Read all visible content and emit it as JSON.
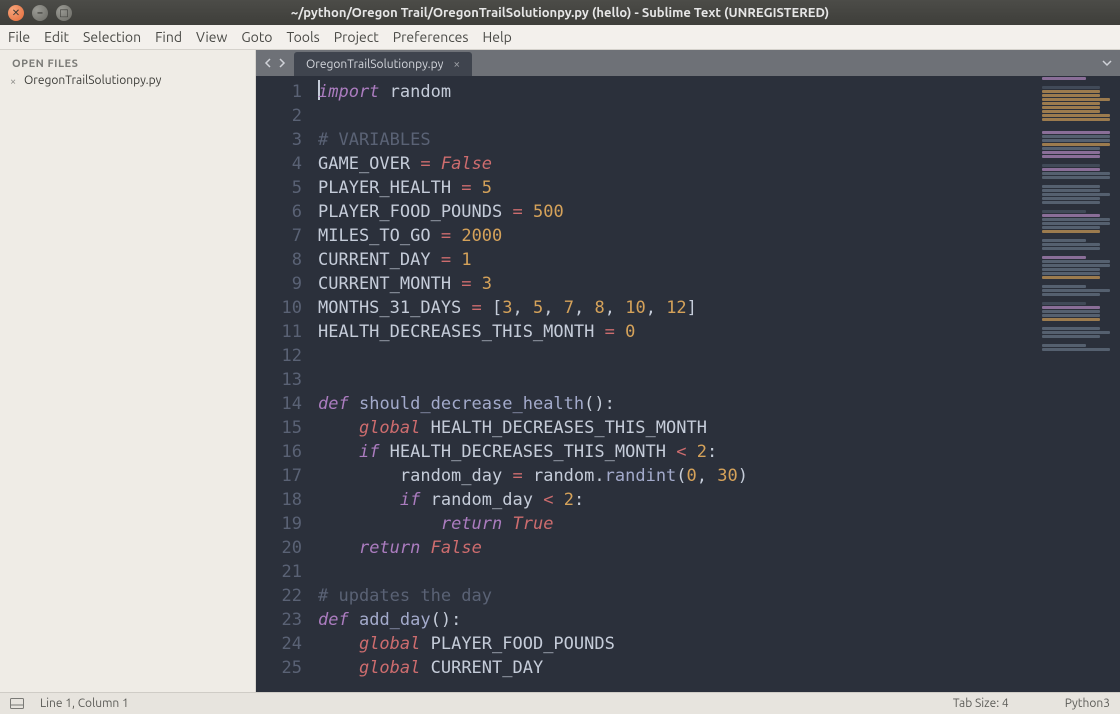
{
  "window": {
    "title": "~/python/Oregon Trail/OregonTrailSolutionpy.py (hello) - Sublime Text (UNREGISTERED)"
  },
  "menu": [
    "File",
    "Edit",
    "Selection",
    "Find",
    "View",
    "Goto",
    "Tools",
    "Project",
    "Preferences",
    "Help"
  ],
  "sidebar": {
    "heading": "OPEN FILES",
    "files": [
      "OregonTrailSolutionpy.py"
    ]
  },
  "tabs": {
    "active": "OregonTrailSolutionpy.py"
  },
  "editor": {
    "line_numbers": [
      "1",
      "2",
      "3",
      "4",
      "5",
      "6",
      "7",
      "8",
      "9",
      "10",
      "11",
      "12",
      "13",
      "14",
      "15",
      "16",
      "17",
      "18",
      "19",
      "20",
      "21",
      "22",
      "23",
      "24",
      "25"
    ],
    "code_lines": {
      "1": {
        "tokens": [
          [
            "kw-imp",
            "import"
          ],
          [
            "txt",
            " random"
          ]
        ]
      },
      "2": {
        "tokens": [
          [
            "txt",
            ""
          ]
        ]
      },
      "3": {
        "tokens": [
          [
            "cmt",
            "# VARIABLES"
          ]
        ]
      },
      "4": {
        "tokens": [
          [
            "var",
            "GAME_OVER "
          ],
          [
            "op",
            "="
          ],
          [
            "txt",
            " "
          ],
          [
            "const",
            "False"
          ]
        ]
      },
      "5": {
        "tokens": [
          [
            "var",
            "PLAYER_HEALTH "
          ],
          [
            "op",
            "="
          ],
          [
            "txt",
            " "
          ],
          [
            "num",
            "5"
          ]
        ]
      },
      "6": {
        "tokens": [
          [
            "var",
            "PLAYER_FOOD_POUNDS "
          ],
          [
            "op",
            "="
          ],
          [
            "txt",
            " "
          ],
          [
            "num",
            "500"
          ]
        ]
      },
      "7": {
        "tokens": [
          [
            "var",
            "MILES_TO_GO "
          ],
          [
            "op",
            "="
          ],
          [
            "txt",
            " "
          ],
          [
            "num",
            "2000"
          ]
        ]
      },
      "8": {
        "tokens": [
          [
            "var",
            "CURRENT_DAY "
          ],
          [
            "op",
            "="
          ],
          [
            "txt",
            " "
          ],
          [
            "num",
            "1"
          ]
        ]
      },
      "9": {
        "tokens": [
          [
            "var",
            "CURRENT_MONTH "
          ],
          [
            "op",
            "="
          ],
          [
            "txt",
            " "
          ],
          [
            "num",
            "3"
          ]
        ]
      },
      "10": {
        "tokens": [
          [
            "var",
            "MONTHS_31_DAYS "
          ],
          [
            "op",
            "="
          ],
          [
            "txt",
            " "
          ],
          [
            "punct",
            "["
          ],
          [
            "num",
            "3"
          ],
          [
            "punct",
            ", "
          ],
          [
            "num",
            "5"
          ],
          [
            "punct",
            ", "
          ],
          [
            "num",
            "7"
          ],
          [
            "punct",
            ", "
          ],
          [
            "num",
            "8"
          ],
          [
            "punct",
            ", "
          ],
          [
            "num",
            "10"
          ],
          [
            "punct",
            ", "
          ],
          [
            "num",
            "12"
          ],
          [
            "punct",
            "]"
          ]
        ]
      },
      "11": {
        "tokens": [
          [
            "var",
            "HEALTH_DECREASES_THIS_MONTH "
          ],
          [
            "op",
            "="
          ],
          [
            "txt",
            " "
          ],
          [
            "num",
            "0"
          ]
        ]
      },
      "12": {
        "tokens": [
          [
            "txt",
            ""
          ]
        ]
      },
      "13": {
        "tokens": [
          [
            "txt",
            ""
          ]
        ]
      },
      "14": {
        "tokens": [
          [
            "kw-def",
            "def"
          ],
          [
            "txt",
            " "
          ],
          [
            "fn",
            "should_decrease_health"
          ],
          [
            "punct",
            "():"
          ]
        ]
      },
      "15": {
        "tokens": [
          [
            "txt",
            "    "
          ],
          [
            "kw-glb",
            "global"
          ],
          [
            "txt",
            " HEALTH_DECREASES_THIS_MONTH"
          ]
        ]
      },
      "16": {
        "tokens": [
          [
            "txt",
            "    "
          ],
          [
            "kw-if",
            "if"
          ],
          [
            "txt",
            " HEALTH_DECREASES_THIS_MONTH "
          ],
          [
            "op",
            "<"
          ],
          [
            "txt",
            " "
          ],
          [
            "num",
            "2"
          ],
          [
            "punct",
            ":"
          ]
        ]
      },
      "17": {
        "tokens": [
          [
            "txt",
            "        random_day "
          ],
          [
            "op",
            "="
          ],
          [
            "txt",
            " "
          ],
          [
            "obj",
            "random"
          ],
          [
            "punct",
            "."
          ],
          [
            "fncall",
            "randint"
          ],
          [
            "punct",
            "("
          ],
          [
            "num",
            "0"
          ],
          [
            "punct",
            ", "
          ],
          [
            "num",
            "30"
          ],
          [
            "punct",
            ")"
          ]
        ]
      },
      "18": {
        "tokens": [
          [
            "txt",
            "        "
          ],
          [
            "kw-if",
            "if"
          ],
          [
            "txt",
            " random_day "
          ],
          [
            "op",
            "<"
          ],
          [
            "txt",
            " "
          ],
          [
            "num",
            "2"
          ],
          [
            "punct",
            ":"
          ]
        ]
      },
      "19": {
        "tokens": [
          [
            "txt",
            "            "
          ],
          [
            "kw-ret",
            "return"
          ],
          [
            "txt",
            " "
          ],
          [
            "const",
            "True"
          ]
        ]
      },
      "20": {
        "tokens": [
          [
            "txt",
            "    "
          ],
          [
            "kw-ret",
            "return"
          ],
          [
            "txt",
            " "
          ],
          [
            "const",
            "False"
          ]
        ]
      },
      "21": {
        "tokens": [
          [
            "txt",
            ""
          ]
        ]
      },
      "22": {
        "tokens": [
          [
            "cmt",
            "# updates the day"
          ]
        ]
      },
      "23": {
        "tokens": [
          [
            "kw-def",
            "def"
          ],
          [
            "txt",
            " "
          ],
          [
            "fn",
            "add_day"
          ],
          [
            "punct",
            "():"
          ]
        ]
      },
      "24": {
        "tokens": [
          [
            "txt",
            "    "
          ],
          [
            "kw-glb",
            "global"
          ],
          [
            "txt",
            " PLAYER_FOOD_POUNDS"
          ]
        ]
      },
      "25": {
        "tokens": [
          [
            "txt",
            "    "
          ],
          [
            "kw-glb",
            "global"
          ],
          [
            "txt",
            " CURRENT_DAY"
          ]
        ]
      }
    }
  },
  "statusbar": {
    "position": "Line 1, Column 1",
    "tab_size": "Tab Size: 4",
    "syntax": "Python3"
  }
}
